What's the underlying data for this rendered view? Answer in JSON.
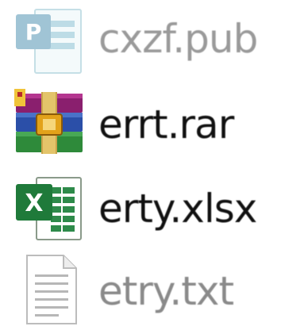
{
  "files": [
    {
      "name": "cxzf.pub",
      "icon": "publisher-file-icon",
      "state": "dimmed"
    },
    {
      "name": "errt.rar",
      "icon": "rar-archive-icon",
      "state": "normal"
    },
    {
      "name": "erty.xlsx",
      "icon": "excel-file-icon",
      "state": "normal"
    },
    {
      "name": "etry.txt",
      "icon": "text-file-icon",
      "state": "dimmed"
    }
  ],
  "colors": {
    "dimmed_text": "#9a9a9a",
    "normal_text": "#111111",
    "excel_green": "#1f7a3a",
    "publisher_blue": "#2f7ea3"
  }
}
